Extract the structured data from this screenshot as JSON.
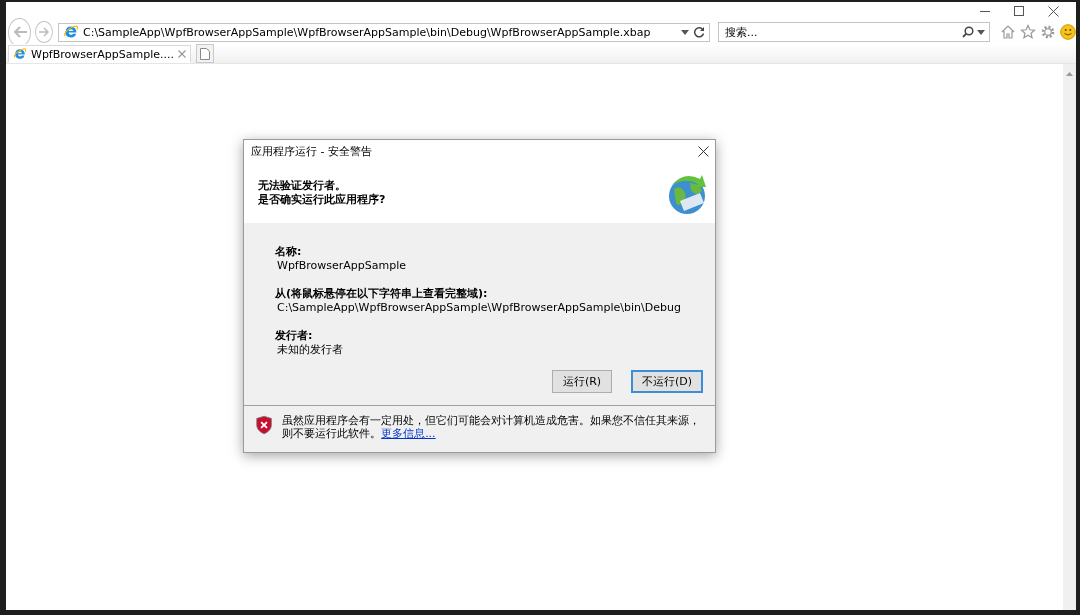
{
  "browser": {
    "address": "C:\\SampleApp\\WpfBrowserAppSample\\WpfBrowserAppSample\\bin\\Debug\\WpfBrowserAppSample.xbap",
    "search": {
      "placeholder": "搜索..."
    },
    "tabs": [
      {
        "label": "WpfBrowserAppSample....",
        "selected": true
      }
    ]
  },
  "dialog": {
    "title": "应用程序运行 - 安全警告",
    "heading": [
      "无法验证发行者。",
      "是否确实运行此应用程序?"
    ],
    "fields": [
      {
        "label": "名称:",
        "value": "WpfBrowserAppSample"
      },
      {
        "label": "从(将鼠标悬停在以下字符串上查看完整域):",
        "value": "C:\\SampleApp\\WpfBrowserAppSample\\WpfBrowserAppSample\\bin\\Debug"
      },
      {
        "label": "发行者:",
        "value": "未知的发行者"
      }
    ],
    "buttons": [
      {
        "label": "运行(R)",
        "default": false
      },
      {
        "label": "不运行(D)",
        "default": true
      }
    ],
    "warning": {
      "text": "虽然应用程序会有一定用处，但它们可能会对计算机造成危害。如果您不信任其来源，则不要运行此软件。",
      "link": "更多信息..."
    }
  }
}
